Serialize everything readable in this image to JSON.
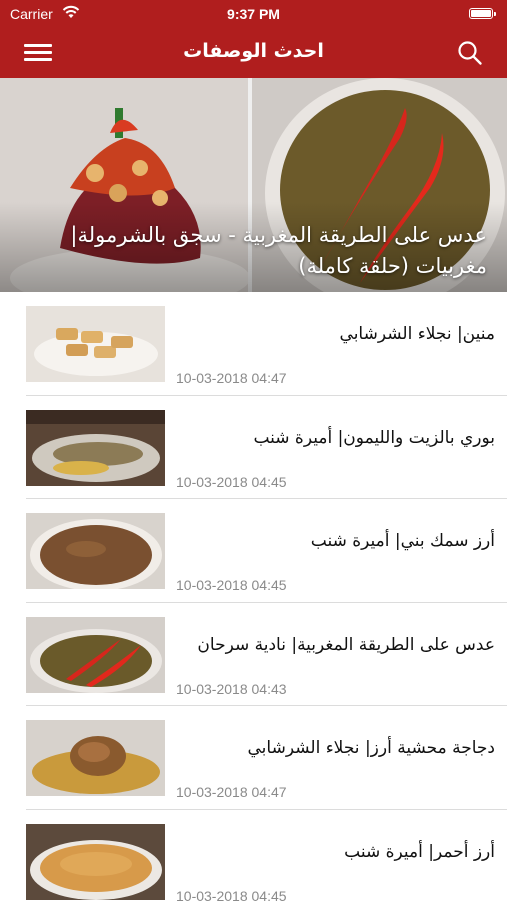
{
  "status_bar": {
    "carrier": "Carrier",
    "time": "9:37 PM"
  },
  "nav": {
    "title": "احدث الوصفات",
    "menu_icon": "hamburger-icon",
    "search_icon": "search-icon"
  },
  "hero": {
    "caption": "عدس على الطريقة المغربية - سجق بالشرمولة| مغربيات (حلقة كاملة)"
  },
  "colors": {
    "accent": "#b01e1e",
    "date_text": "#8a8a8a",
    "separator": "#dcdcdc"
  },
  "recipes": [
    {
      "title": "منين| نجلاء الشرشابي",
      "date": "10-03-2018 04:47",
      "thumb_label": "منين"
    },
    {
      "title": "بوري بالزيت والليمون| أميرة شنب",
      "date": "10-03-2018 04:45",
      "thumb_label": "بوري بالزيت و الليمون"
    },
    {
      "title": "أرز سمك بني| أميرة شنب",
      "date": "10-03-2018 04:45",
      "thumb_label": "ارز سمك بني"
    },
    {
      "title": "عدس على الطريقة المغربية| نادية سرحان",
      "date": "10-03-2018 04:43",
      "thumb_label": "عدس على الطريقة المغربية"
    },
    {
      "title": "دجاجة محشية أرز| نجلاء الشرشابي",
      "date": "10-03-2018 04:47",
      "thumb_label": "دجاجة محشية ارز"
    },
    {
      "title": "أرز أحمر| أميرة شنب",
      "date": "10-03-2018 04:45",
      "thumb_label": "ارز احمر"
    }
  ]
}
